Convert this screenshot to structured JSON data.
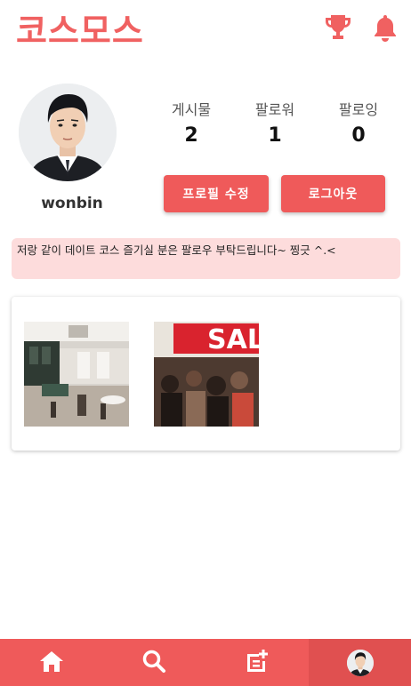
{
  "header": {
    "logo": "코스모스",
    "icons": [
      "trophy-icon",
      "bell-icon"
    ],
    "accent_color": "#f06161"
  },
  "profile": {
    "username": "wonbin",
    "stats": [
      {
        "label": "게시물",
        "value": "2"
      },
      {
        "label": "팔로워",
        "value": "1"
      },
      {
        "label": "팔로잉",
        "value": "0"
      }
    ],
    "edit_button": "프로필 수정",
    "logout_button": "로그아웃",
    "bio": "저랑 같이 데이트 코스 즐기실 분은 팔로우 부탁드립니다~ 찡긋 ^.<"
  },
  "posts": {
    "thumbs": [
      "cafe-interior-photo",
      "sale-store-photo"
    ],
    "sale_sign_text": "SAL"
  },
  "bottom_nav": {
    "items": [
      "home-icon",
      "search-icon",
      "write-icon",
      "profile-avatar"
    ],
    "bar_color": "#ef5a5a"
  }
}
